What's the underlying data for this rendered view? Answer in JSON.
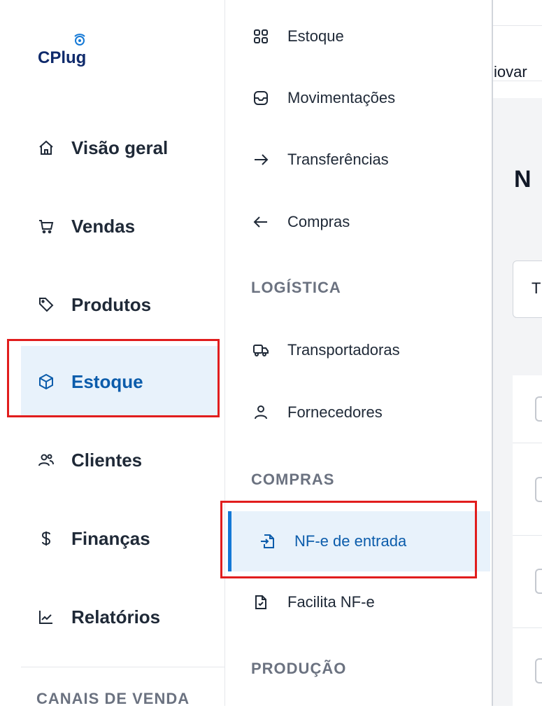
{
  "logo": {
    "text": "CPlug"
  },
  "sidebar": {
    "items": [
      {
        "label": "Visão geral",
        "icon": "home-icon"
      },
      {
        "label": "Vendas",
        "icon": "cart-icon"
      },
      {
        "label": "Produtos",
        "icon": "tag-icon"
      },
      {
        "label": "Estoque",
        "icon": "box-icon",
        "active": true
      },
      {
        "label": "Clientes",
        "icon": "users-icon"
      },
      {
        "label": "Finanças",
        "icon": "dollar-icon"
      },
      {
        "label": "Relatórios",
        "icon": "chart-icon"
      }
    ],
    "section_bottom": "CANAIS DE VENDA"
  },
  "submenu": {
    "items": [
      {
        "label": "Estoque",
        "icon": "grid-icon"
      },
      {
        "label": "Movimentações",
        "icon": "inbox-icon"
      },
      {
        "label": "Transferências",
        "icon": "arrow-right-icon"
      },
      {
        "label": "Compras",
        "icon": "arrow-left-icon"
      },
      {
        "label": "Transportadoras",
        "icon": "truck-icon"
      },
      {
        "label": "Fornecedores",
        "icon": "user-icon"
      },
      {
        "label": "NF-e de entrada",
        "icon": "file-import-icon",
        "active": true
      },
      {
        "label": "Facilita NF-e",
        "icon": "file-check-icon"
      }
    ],
    "headers": {
      "logistica": "LOGÍSTICA",
      "compras": "COMPRAS",
      "producao": "PRODUÇÃO"
    }
  },
  "content": {
    "user_name": "iovar",
    "page_title": "N",
    "filter_text": "T"
  },
  "colors": {
    "accent": "#0b5cab",
    "active_bg": "#e8f2fb",
    "highlight": "#e11d1d"
  }
}
